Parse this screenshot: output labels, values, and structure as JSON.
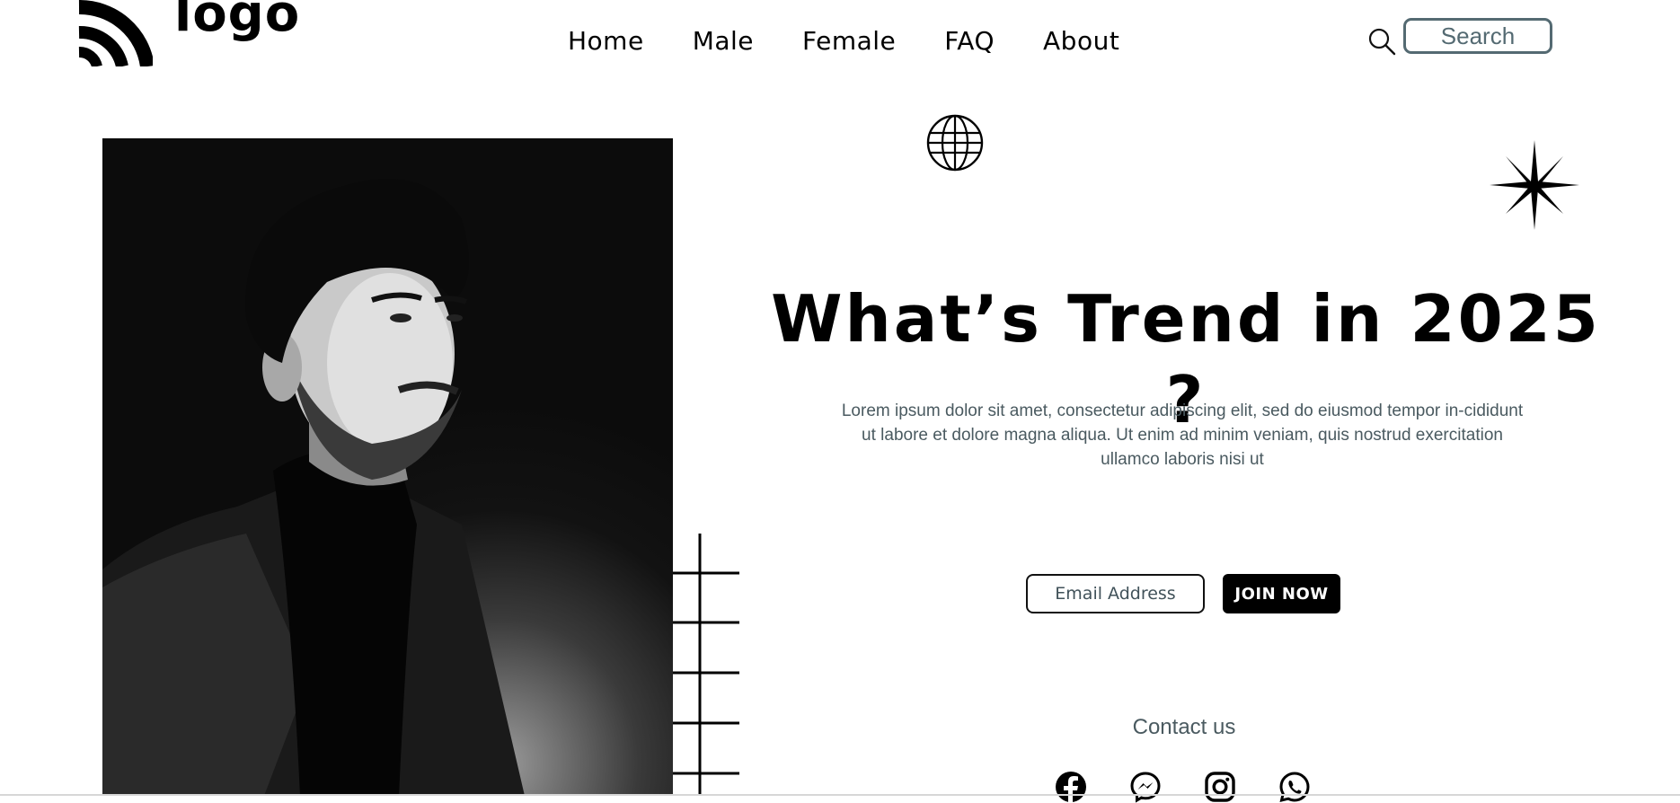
{
  "brand": {
    "logo_text": "logo",
    "icon": "brand-arcs-icon"
  },
  "nav": {
    "items": [
      {
        "label": "Home"
      },
      {
        "label": "Male"
      },
      {
        "label": "Female"
      },
      {
        "label": "FAQ"
      },
      {
        "label": "About"
      }
    ]
  },
  "search": {
    "icon": "search-icon",
    "placeholder": "Search"
  },
  "hero": {
    "photo_icon": "portrait-photo",
    "decorations": [
      "globe-icon",
      "star-icon",
      "grid-lines"
    ],
    "headline": "What’s Trend in 2025 ?",
    "lead": "Lorem ipsum dolor sit amet, consectetur adipiscing elit, sed do eiusmod tempor in-cididunt ut labore et dolore magna aliqua. Ut enim ad minim veniam, quis nostrud exercitation ullamco laboris nisi ut"
  },
  "signup": {
    "email_placeholder": "Email Address",
    "join_label": "JOIN NOW"
  },
  "contact": {
    "title": "Contact us",
    "socials": [
      "facebook-icon",
      "messenger-icon",
      "instagram-icon",
      "whatsapp-icon"
    ]
  },
  "colors": {
    "text": "#000000",
    "muted": "#4a5a60",
    "search_border": "#546a72",
    "button_bg": "#000000",
    "button_text": "#ffffff"
  }
}
